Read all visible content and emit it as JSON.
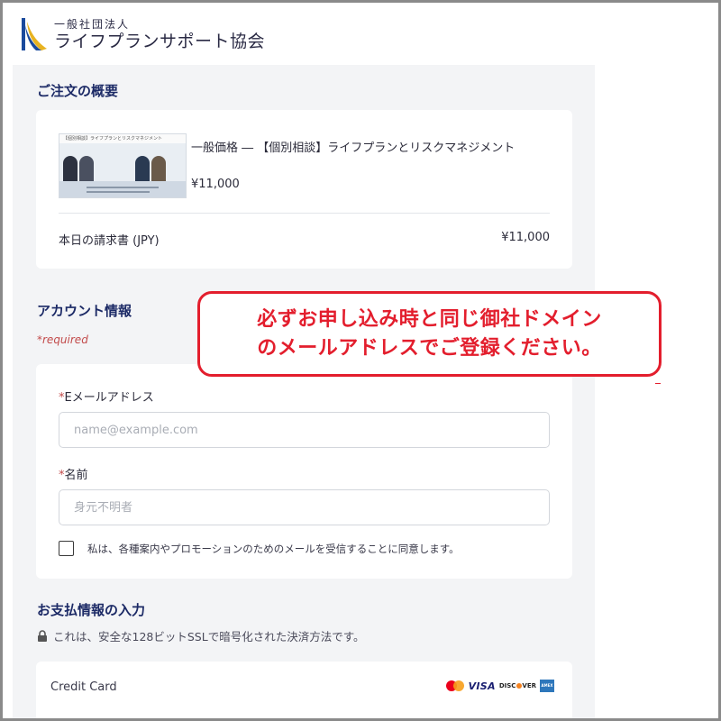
{
  "header": {
    "logo_sub": "一般社団法人",
    "logo_main": "ライフプランサポート協会",
    "logo_icon": "wave-logo-icon"
  },
  "order_summary": {
    "title": "ご注文の概要",
    "product_name": "一般価格 ― 【個別相談】ライフプランとリスクマネジメント",
    "product_price": "¥11,000",
    "thumbnail_caption": "【個別相談】ライフプランとリスクマネジメント",
    "total_label": "本日の請求書 (JPY)",
    "total_value": "¥11,000"
  },
  "account": {
    "title": "アカウント情報",
    "required_note": "*required",
    "email_label": "Eメールアドレス",
    "email_placeholder": "name@example.com",
    "email_value": "",
    "name_label": "名前",
    "name_placeholder": "身元不明者",
    "name_value": "",
    "required_mark": "*",
    "consent_text": "私は、各種案内やプロモーションのためのメールを受信することに同意します。",
    "consent_checked": false
  },
  "payment": {
    "title": "お支払情報の入力",
    "security_note": "これは、安全な128ビットSSLで暗号化された決済方法です。",
    "method_label": "Credit Card",
    "brands": [
      "mastercard",
      "VISA",
      "DISCOVER",
      "amex"
    ],
    "visa_text": "VISA",
    "discover_left": "DISC",
    "discover_right": "VER",
    "amex_text": "AMEX"
  },
  "callout": {
    "line1": "必ずお申し込み時と同じ御社ドメイン",
    "line2": "のメールアドレスでご登録ください。"
  },
  "colors": {
    "accent_red": "#e31e2d",
    "heading_navy": "#1c2a66",
    "panel_bg": "#f3f4f6",
    "logo_blue": "#1b4a9c",
    "logo_gold": "#e8b321"
  }
}
